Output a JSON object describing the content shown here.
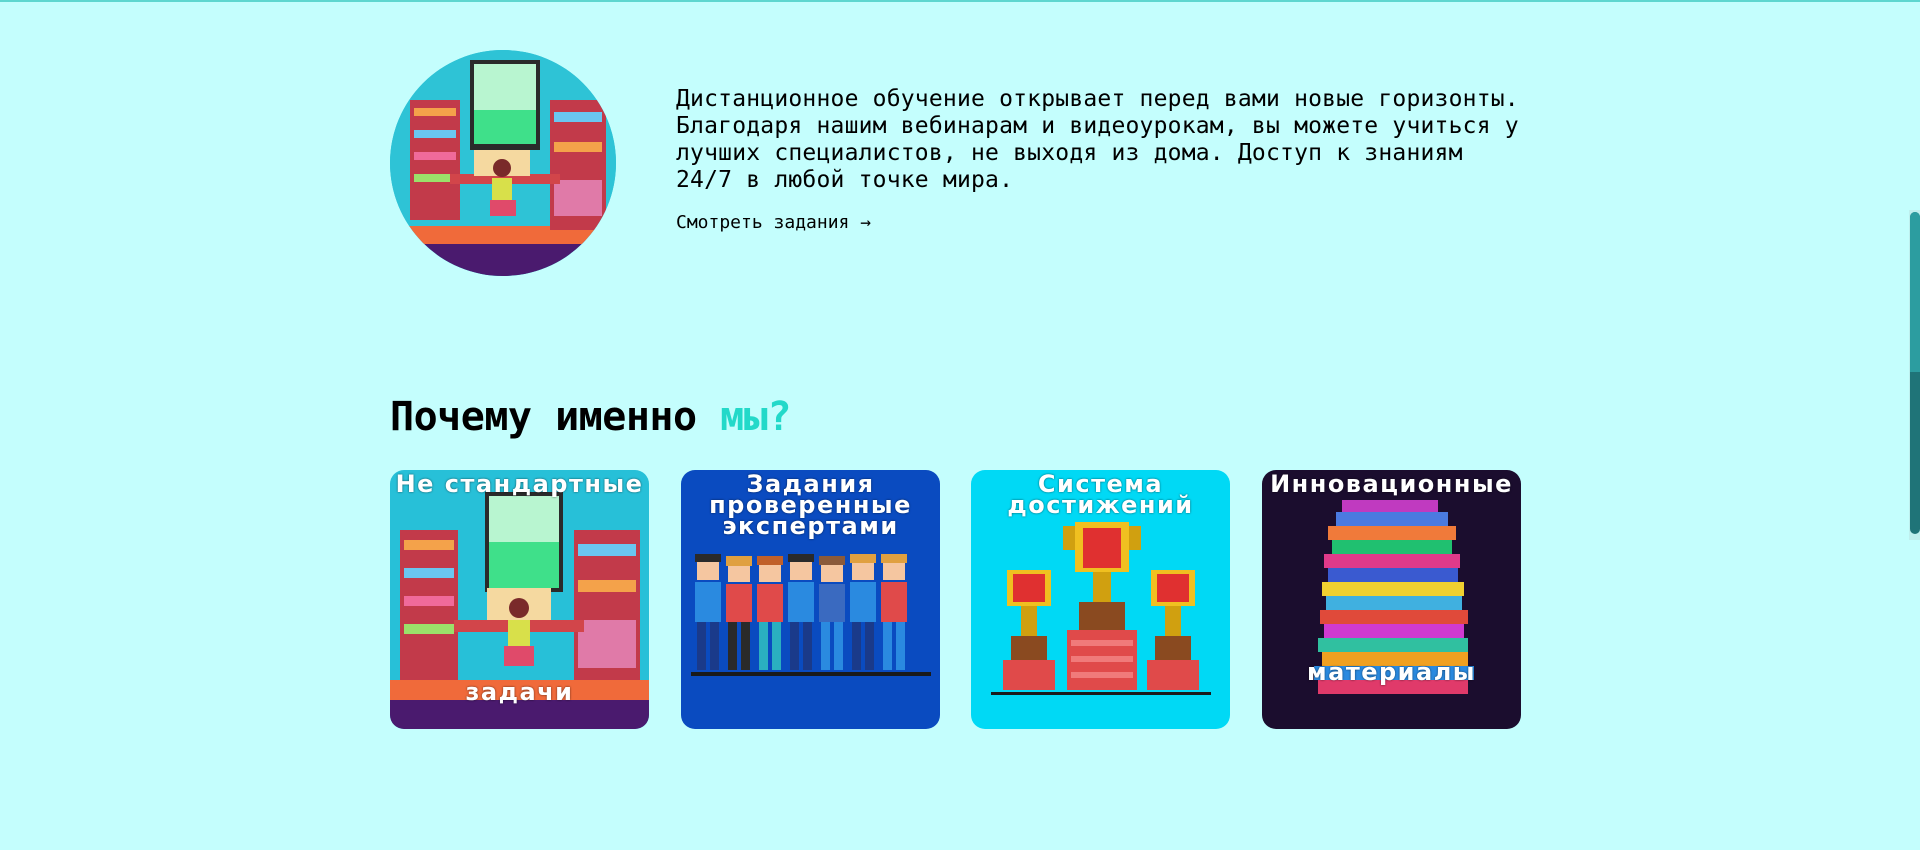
{
  "hero": {
    "text": "Дистанционное обучение открывает перед вами новые горизонты. Благодаря нашим вебинарам и видеоурокам, вы можете учиться у лучших специалистов, не выходя из дома. Доступ к знаниям 24/7 в любой точке мира.",
    "link_label": "Смотреть задания →"
  },
  "section": {
    "title_main": "Почему именно",
    "title_accent": "мы?"
  },
  "cards": [
    {
      "top": "Не стандартные",
      "bottom": "задачи",
      "bg": "#27c0d8"
    },
    {
      "top": "Задания проверенные экспертами",
      "bottom": "",
      "bg": "#0a4bc0"
    },
    {
      "top": "Система достижений",
      "bottom": "",
      "bg": "#00d9f5"
    },
    {
      "top": "Инновационные",
      "bottom": "материалы",
      "bg": "#1b0d2e"
    }
  ],
  "colors": {
    "page_bg": "#c4fefd",
    "accent": "#23d9c9"
  }
}
